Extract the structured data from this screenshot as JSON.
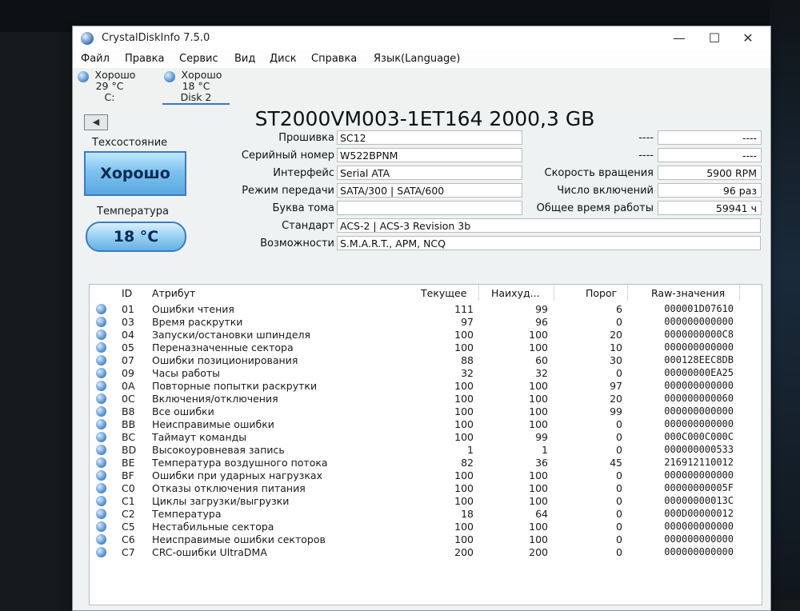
{
  "window": {
    "title": "CrystalDiskInfo 7.5.0",
    "minimize_glyph": "—",
    "maximize_glyph": "☐",
    "close_glyph": "✕"
  },
  "menu": [
    "Файл",
    "Правка",
    "Сервис",
    "Вид",
    "Диск",
    "Справка",
    "Язык(Language)"
  ],
  "disk_tabs": [
    {
      "status": "Хорошо",
      "temp": "29 °C",
      "name": "C:"
    },
    {
      "status": "Хорошо",
      "temp": "18 °C",
      "name": "Disk 2"
    }
  ],
  "drive": {
    "back_glyph": "◀",
    "model": "ST2000VM003-1ET164 2000,3 GB",
    "health_label": "Техсостояние",
    "health_value": "Хорошо",
    "temp_label": "Температура",
    "temp_value": "18 °C",
    "info": [
      {
        "label": "Прошивка",
        "value": "SC12"
      },
      {
        "label": "Серийный номер",
        "value": "W522BPNM"
      },
      {
        "label": "Интерфейс",
        "value": "Serial ATA"
      },
      {
        "label": "Режим передачи",
        "value": "SATA/300 | SATA/600"
      },
      {
        "label": "Буква тома",
        "value": ""
      },
      {
        "label": "Стандарт",
        "value": "ACS-2 | ACS-3 Revision 3b"
      },
      {
        "label": "Возможности",
        "value": "S.M.A.R.T., APM, NCQ"
      }
    ],
    "stats": [
      {
        "label": "----",
        "value": "----"
      },
      {
        "label": "----",
        "value": "----"
      },
      {
        "label": "Скорость вращения",
        "value": "5900 RPM"
      },
      {
        "label": "Число включений",
        "value": "96 раз"
      },
      {
        "label": "Общее время работы",
        "value": "59941 ч"
      }
    ]
  },
  "smart": {
    "columns": [
      "ID",
      "Атрибут",
      "Текущее",
      "Наихуд...",
      "Порог",
      "Raw-значения"
    ],
    "rows": [
      {
        "id": "01",
        "name": "Ошибки чтения",
        "current": "111",
        "worst": "99",
        "threshold": "6",
        "raw": "000001D07610"
      },
      {
        "id": "03",
        "name": "Время раскрутки",
        "current": "97",
        "worst": "96",
        "threshold": "0",
        "raw": "000000000000"
      },
      {
        "id": "04",
        "name": "Запуски/остановки шпинделя",
        "current": "100",
        "worst": "100",
        "threshold": "20",
        "raw": "0000000000C8"
      },
      {
        "id": "05",
        "name": "Переназначенные сектора",
        "current": "100",
        "worst": "100",
        "threshold": "10",
        "raw": "000000000000"
      },
      {
        "id": "07",
        "name": "Ошибки позиционирования",
        "current": "88",
        "worst": "60",
        "threshold": "30",
        "raw": "000128EEC8DB"
      },
      {
        "id": "09",
        "name": "Часы работы",
        "current": "32",
        "worst": "32",
        "threshold": "0",
        "raw": "00000000EA25"
      },
      {
        "id": "0A",
        "name": "Повторные попытки раскрутки",
        "current": "100",
        "worst": "100",
        "threshold": "97",
        "raw": "000000000000"
      },
      {
        "id": "0C",
        "name": "Включения/отключения",
        "current": "100",
        "worst": "100",
        "threshold": "20",
        "raw": "000000000060"
      },
      {
        "id": "B8",
        "name": "Все ошибки",
        "current": "100",
        "worst": "100",
        "threshold": "99",
        "raw": "000000000000"
      },
      {
        "id": "BB",
        "name": "Неисправимые ошибки",
        "current": "100",
        "worst": "100",
        "threshold": "0",
        "raw": "000000000000"
      },
      {
        "id": "BC",
        "name": "Таймаут команды",
        "current": "100",
        "worst": "99",
        "threshold": "0",
        "raw": "000C000C000C"
      },
      {
        "id": "BD",
        "name": "Высокоуровневая запись",
        "current": "1",
        "worst": "1",
        "threshold": "0",
        "raw": "000000000533"
      },
      {
        "id": "BE",
        "name": "Температура воздушного потока",
        "current": "82",
        "worst": "36",
        "threshold": "45",
        "raw": "216912110012"
      },
      {
        "id": "BF",
        "name": "Ошибки при ударных нагрузках",
        "current": "100",
        "worst": "100",
        "threshold": "0",
        "raw": "000000000000"
      },
      {
        "id": "C0",
        "name": "Отказы отключения питания",
        "current": "100",
        "worst": "100",
        "threshold": "0",
        "raw": "00000000005F"
      },
      {
        "id": "C1",
        "name": "Циклы загрузки/выгрузки",
        "current": "100",
        "worst": "100",
        "threshold": "0",
        "raw": "00000000013C"
      },
      {
        "id": "C2",
        "name": "Температура",
        "current": "18",
        "worst": "64",
        "threshold": "0",
        "raw": "000D00000012"
      },
      {
        "id": "C5",
        "name": "Нестабильные сектора",
        "current": "100",
        "worst": "100",
        "threshold": "0",
        "raw": "000000000000"
      },
      {
        "id": "C6",
        "name": "Неисправимые ошибки секторов",
        "current": "100",
        "worst": "100",
        "threshold": "0",
        "raw": "000000000000"
      },
      {
        "id": "C7",
        "name": "CRC-ошибки UltraDMA",
        "current": "200",
        "worst": "200",
        "threshold": "0",
        "raw": "000000000000"
      }
    ]
  }
}
